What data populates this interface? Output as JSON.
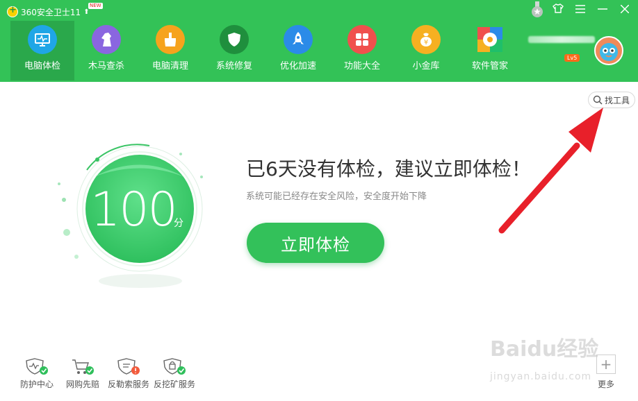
{
  "app": {
    "title": "360安全卫士11",
    "new_badge": "NEW"
  },
  "window_controls": {
    "skin_icon": "shirt-icon",
    "menu_icon": "menu-icon",
    "minimize_icon": "minimize-icon",
    "close_icon": "close-icon"
  },
  "nav": {
    "items": [
      {
        "label": "电脑体检",
        "icon": "monitor-icon",
        "active": true
      },
      {
        "label": "木马查杀",
        "icon": "horse-icon"
      },
      {
        "label": "电脑清理",
        "icon": "broom-icon"
      },
      {
        "label": "系统修复",
        "icon": "shield-icon"
      },
      {
        "label": "优化加速",
        "icon": "rocket-icon"
      },
      {
        "label": "功能大全",
        "icon": "grid-icon"
      },
      {
        "label": "小金库",
        "icon": "coin-icon"
      },
      {
        "label": "软件管家",
        "icon": "apps-icon"
      }
    ]
  },
  "user": {
    "level": "Lv5"
  },
  "toolbar": {
    "find_tools": "找工具"
  },
  "score": {
    "value": "100",
    "unit": "分"
  },
  "main": {
    "headline": "已6天没有体检，建议立即体检！",
    "subline": "系统可能已经存在安全风险，安全度开始下降",
    "scan_button": "立即体检"
  },
  "bottom": {
    "tools": [
      {
        "label": "防护中心"
      },
      {
        "label": "网购先赔"
      },
      {
        "label": "反勒索服务"
      },
      {
        "label": "反挖矿服务"
      }
    ],
    "more": "更多"
  },
  "watermark": {
    "text": "Baidu经验",
    "url": "jingyan.baidu.com"
  },
  "colors": {
    "brand_green": "#33c257",
    "button_green": "#33c15a",
    "arrow_red": "#e8202a"
  }
}
